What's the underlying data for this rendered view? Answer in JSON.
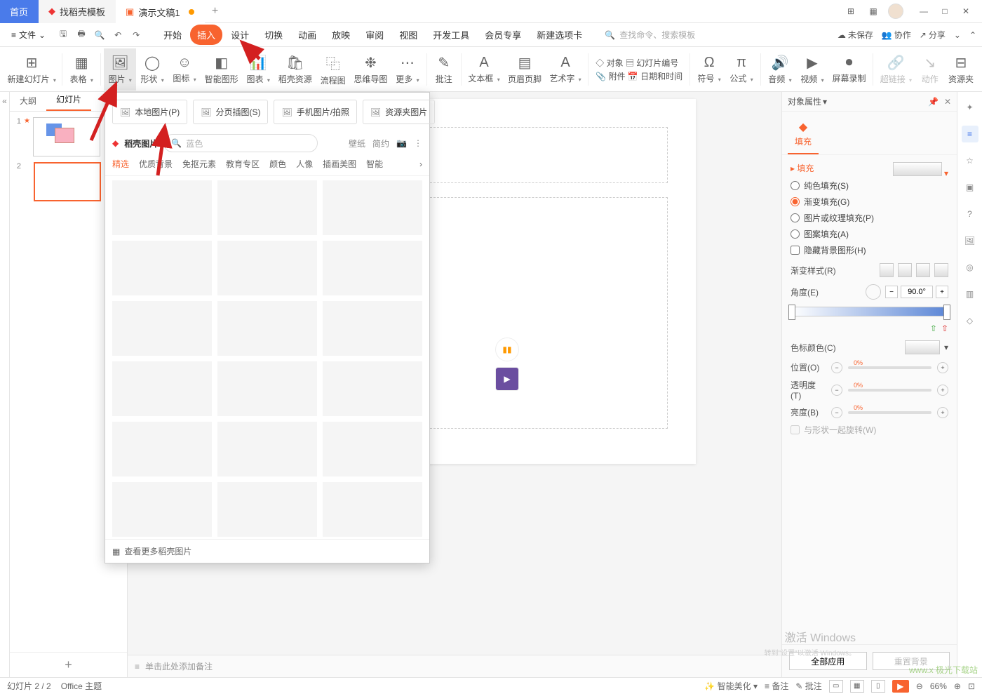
{
  "titlebar": {
    "home_tab": "首页",
    "templates_tab": "找稻壳模板",
    "doc_tab": "演示文稿1",
    "avatar": "user-avatar"
  },
  "menubar": {
    "file_label": "文件",
    "tabs": [
      "开始",
      "插入",
      "设计",
      "切换",
      "动画",
      "放映",
      "审阅",
      "视图",
      "开发工具",
      "会员专享",
      "新建选项卡"
    ],
    "active_tab": "插入",
    "search_placeholder": "查找命令、搜索模板",
    "right": {
      "unsaved": "未保存",
      "collab": "协作",
      "share": "分享"
    }
  },
  "ribbon": {
    "items": [
      {
        "label": "新建幻灯片",
        "icon": "⊞",
        "arr": true,
        "name": "new-slide"
      },
      {
        "label": "表格",
        "icon": "▦",
        "arr": true,
        "name": "table"
      },
      {
        "label": "图片",
        "icon": "🖼",
        "arr": true,
        "name": "picture",
        "hl": true
      },
      {
        "label": "形状",
        "icon": "◯",
        "arr": true,
        "name": "shapes"
      },
      {
        "label": "图标",
        "icon": "☺",
        "arr": true,
        "name": "icons"
      },
      {
        "label": "智能图形",
        "icon": "◧",
        "name": "smart-art"
      },
      {
        "label": "图表",
        "icon": "📊",
        "arr": true,
        "name": "chart"
      },
      {
        "label": "稻壳资源",
        "icon": "🛍",
        "name": "dk-res"
      },
      {
        "label": "流程图",
        "icon": "⿻",
        "name": "flowchart"
      },
      {
        "label": "思维导图",
        "icon": "❉",
        "name": "mindmap"
      },
      {
        "label": "更多",
        "icon": "⋯",
        "arr": true,
        "name": "more"
      },
      {
        "label": "批注",
        "icon": "✎",
        "name": "comment"
      },
      {
        "label": "文本框",
        "icon": "A",
        "arr": true,
        "name": "textbox"
      },
      {
        "label": "页眉页脚",
        "icon": "▤",
        "name": "header-footer"
      },
      {
        "label": "艺术字",
        "icon": "A",
        "arr": true,
        "name": "wordart"
      }
    ],
    "stack1": {
      "a": "对象",
      "b": "附件",
      "c": "幻灯片编号",
      "d": "日期和时间"
    },
    "tail": [
      {
        "label": "符号",
        "icon": "Ω",
        "arr": true,
        "name": "symbol"
      },
      {
        "label": "公式",
        "icon": "π",
        "arr": true,
        "name": "equation"
      },
      {
        "label": "音频",
        "icon": "🔊",
        "arr": true,
        "name": "audio"
      },
      {
        "label": "视频",
        "icon": "▶",
        "arr": true,
        "name": "video"
      },
      {
        "label": "屏幕录制",
        "icon": "⏺",
        "name": "screen-rec"
      },
      {
        "label": "超链接",
        "icon": "🔗",
        "arr": true,
        "name": "link",
        "dim": true
      },
      {
        "label": "动作",
        "icon": "↘",
        "name": "action",
        "dim": true
      },
      {
        "label": "资源夹",
        "icon": "⊟",
        "name": "res-folder"
      }
    ]
  },
  "thumbs": {
    "tabs": {
      "outline": "大纲",
      "slides": "幻灯片"
    },
    "slides": [
      {
        "n": "1"
      },
      {
        "n": "2"
      }
    ]
  },
  "dropdown": {
    "row1": [
      {
        "label": "本地图片(P)",
        "name": "local-image"
      },
      {
        "label": "分页插图(S)",
        "name": "page-illust"
      },
      {
        "label": "手机图片/拍照",
        "name": "phone-image"
      },
      {
        "label": "资源夹图片",
        "name": "folder-image"
      }
    ],
    "brand": "稻壳图片",
    "search_ph": "蓝色",
    "opts": {
      "wallpaper": "壁纸",
      "simple": "简约"
    },
    "cats": [
      "精选",
      "优质背景",
      "免抠元素",
      "教育专区",
      "颜色",
      "人像",
      "插画美图",
      "智能"
    ],
    "footer": "查看更多稻壳图片"
  },
  "props": {
    "title": "对象属性",
    "tab": "填充",
    "section": "填充",
    "radios": {
      "solid": "纯色填充(S)",
      "gradient": "渐变填充(G)",
      "picture": "图片或纹理填充(P)",
      "pattern": "图案填充(A)"
    },
    "hide_bg": "隐藏背景图形(H)",
    "grad_style": "渐变样式(R)",
    "angle": "角度(E)",
    "angle_val": "90.0°",
    "color": "色标颜色(C)",
    "position": "位置(O)",
    "pos_val": "0%",
    "opacity": "透明度(T)",
    "op_val": "0%",
    "brightness": "亮度(B)",
    "br_val": "0%",
    "rotate": "与形状一起旋转(W)",
    "apply_all": "全部应用",
    "reset_bg": "重置背景"
  },
  "notes": {
    "placeholder": "单击此处添加备注"
  },
  "status": {
    "slide": "幻灯片 2 / 2",
    "theme": "Office 主题",
    "beautify": "智能美化",
    "notes": "备注",
    "comments": "批注",
    "zoom": "66%"
  },
  "wm": {
    "activate": "激活 Windows",
    "sub": "转到\"设置\"以激活 Windows。",
    "site": "www.x 极光下载站"
  }
}
